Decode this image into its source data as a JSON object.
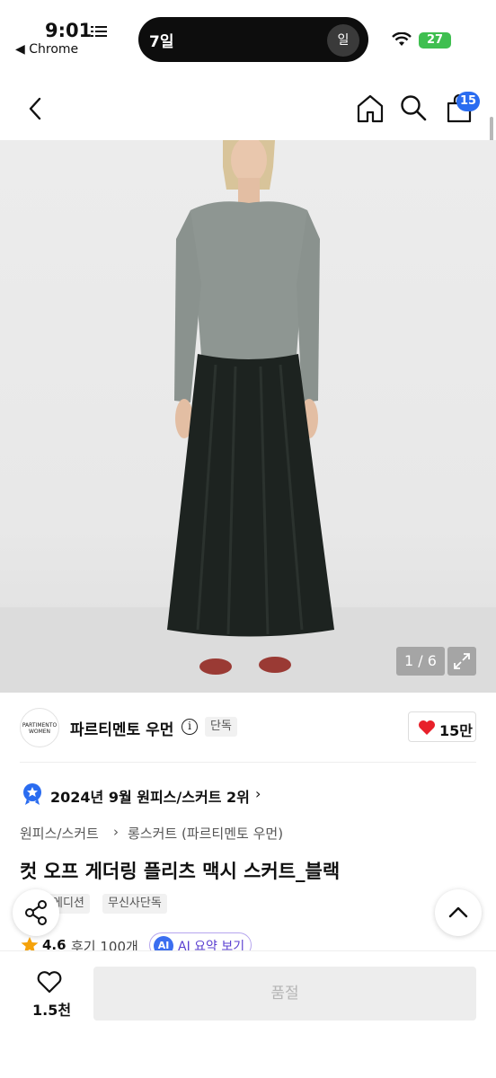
{
  "status_bar": {
    "time": "9:01",
    "back_app": "◀ Chrome",
    "island_left": "7일",
    "island_right": "일",
    "battery": "27"
  },
  "nav": {
    "cart_count": "15"
  },
  "gallery": {
    "counter": "1 / 6"
  },
  "brand": {
    "logo_text_1": "PARTIMENTO",
    "logo_text_2": "WOMEN",
    "name": "파르티멘토 우먼",
    "info": "i",
    "exclusive_tag": "단독",
    "like_count": "15만"
  },
  "ranking": {
    "text": "2024년 9월 원피스/스커트 2위",
    "chevron": "›"
  },
  "category": {
    "level1": "원피스/스커트",
    "separator": "›",
    "level2": "롱스커트 (파르티멘토 우먼)"
  },
  "product": {
    "title": "컷 오프 게더링 플리츠 맥시 스커트_블랙",
    "tags": [
      "에디션",
      "무신사단독"
    ],
    "rating": "4.6",
    "reviews": "후기 100개",
    "ai_badge": "AI",
    "ai_label": "AI 요약 보기"
  },
  "bottom": {
    "wish_count": "1.5천",
    "buy_label": "품절"
  },
  "colors": {
    "accent_blue": "#2a6cf0",
    "heart_red": "#e8202a",
    "soldout_bg": "#ededed"
  },
  "icons": [
    "menu-icon",
    "wifi-icon",
    "back-arrow-icon",
    "home-icon",
    "search-icon",
    "cart-icon",
    "expand-icon",
    "info-icon",
    "heart-icon",
    "ranking-badge-icon",
    "share-icon",
    "chevron-up-icon",
    "star-icon"
  ]
}
